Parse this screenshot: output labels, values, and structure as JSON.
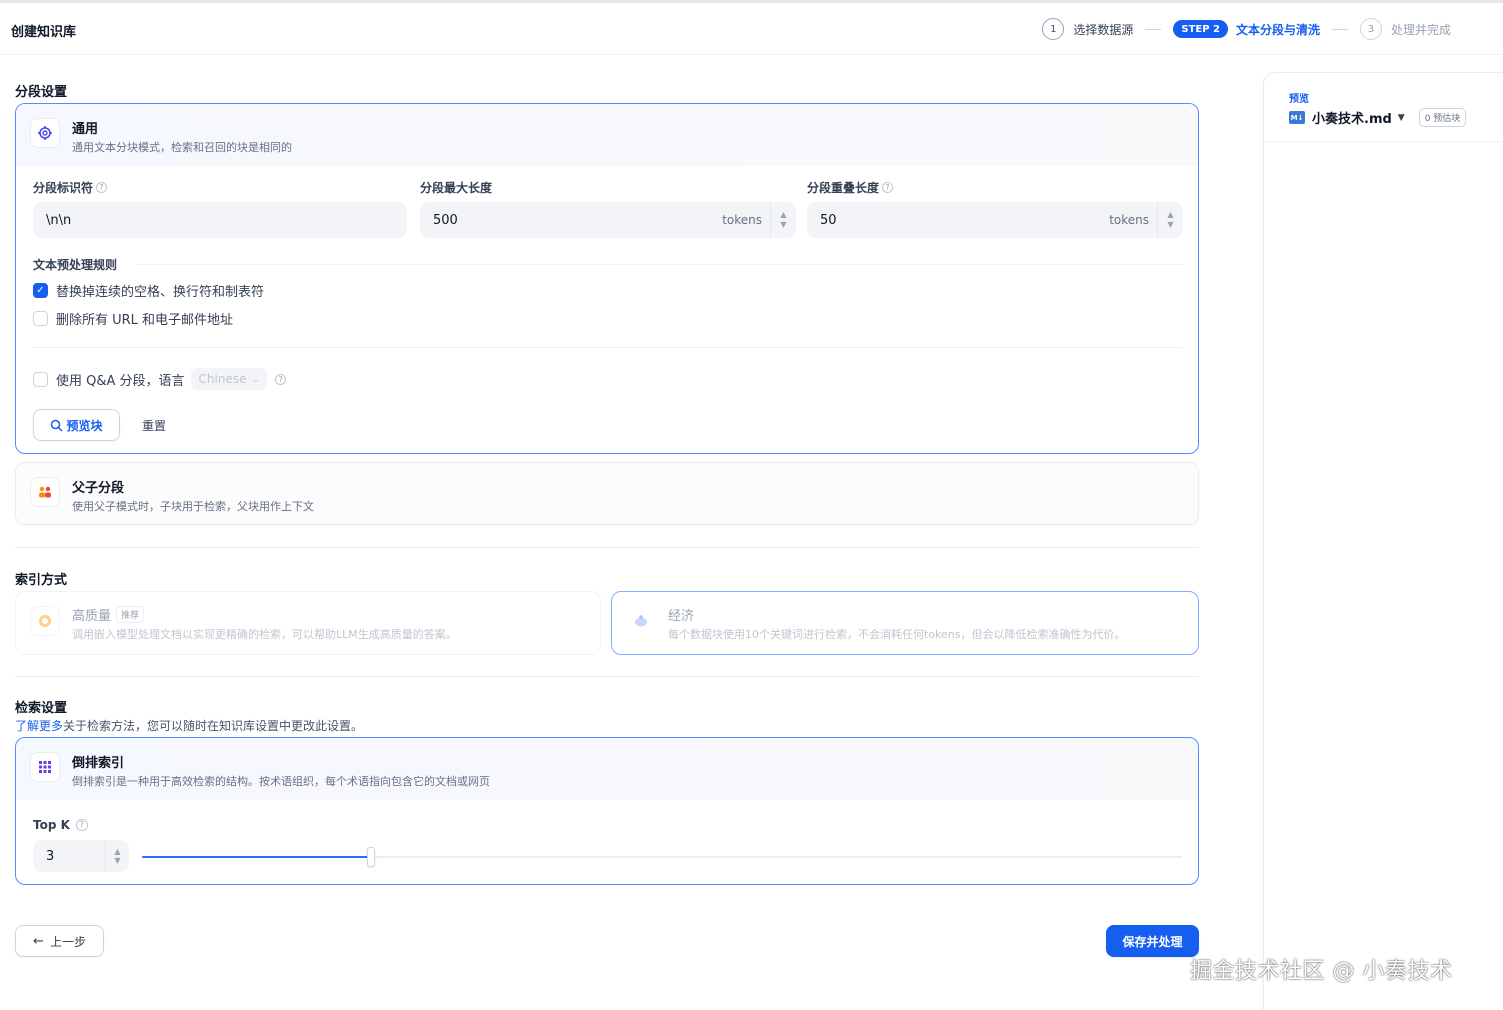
{
  "header": {
    "title": "创建知识库",
    "steps": [
      {
        "num": "1",
        "label": "选择数据源"
      },
      {
        "badge": "STEP 2",
        "label": "文本分段与清洗"
      },
      {
        "num": "3",
        "label": "处理并完成"
      }
    ]
  },
  "segment": {
    "section_title": "分段设置",
    "general": {
      "name": "通用",
      "desc": "通用文本分块模式，检索和召回的块是相同的",
      "separator_label": "分段标识符",
      "separator_value": "\\n\\n",
      "max_len_label": "分段最大长度",
      "max_len_value": "500",
      "overlap_label": "分段重叠长度",
      "overlap_value": "50",
      "unit": "tokens",
      "rules_title": "文本预处理规则",
      "rule1": "替换掉连续的空格、换行符和制表符",
      "rule2": "删除所有 URL 和电子邮件地址",
      "qa_label": "使用 Q&A 分段，语言",
      "qa_lang": "Chinese",
      "preview_btn": "预览块",
      "reset_btn": "重置"
    },
    "parent_child": {
      "name": "父子分段",
      "desc": "使用父子模式时，子块用于检索，父块用作上下文"
    }
  },
  "index": {
    "section_title": "索引方式",
    "high_quality": {
      "name": "高质量",
      "tag": "推荐",
      "desc": "调用嵌入模型处理文档以实现更精确的检索，可以帮助LLM生成高质量的答案。"
    },
    "economy": {
      "name": "经济",
      "desc": "每个数据块使用10个关键词进行检索，不会消耗任何tokens，但会以降低检索准确性为代价。"
    }
  },
  "retrieval": {
    "section_title": "检索设置",
    "link": "了解更多",
    "link_desc": "关于检索方法，您可以随时在知识库设置中更改此设置。",
    "inverted": {
      "name": "倒排索引",
      "desc": "倒排索引是一种用于高效检索的结构。按术语组织，每个术语指向包含它的文档或网页",
      "topk_label": "Top K",
      "topk_value": "3",
      "topk_fraction": 0.22
    }
  },
  "footer": {
    "back_btn": "上一步",
    "save_btn": "保存并处理"
  },
  "preview": {
    "title": "预览",
    "file_icon": "M↓",
    "file_name": "小奏技术.md",
    "estimate": "0 预估块"
  },
  "watermark": "掘金技术社区 @ 小奏技术",
  "colors": {
    "accent": "#155eef",
    "active_border": "#528bff"
  }
}
